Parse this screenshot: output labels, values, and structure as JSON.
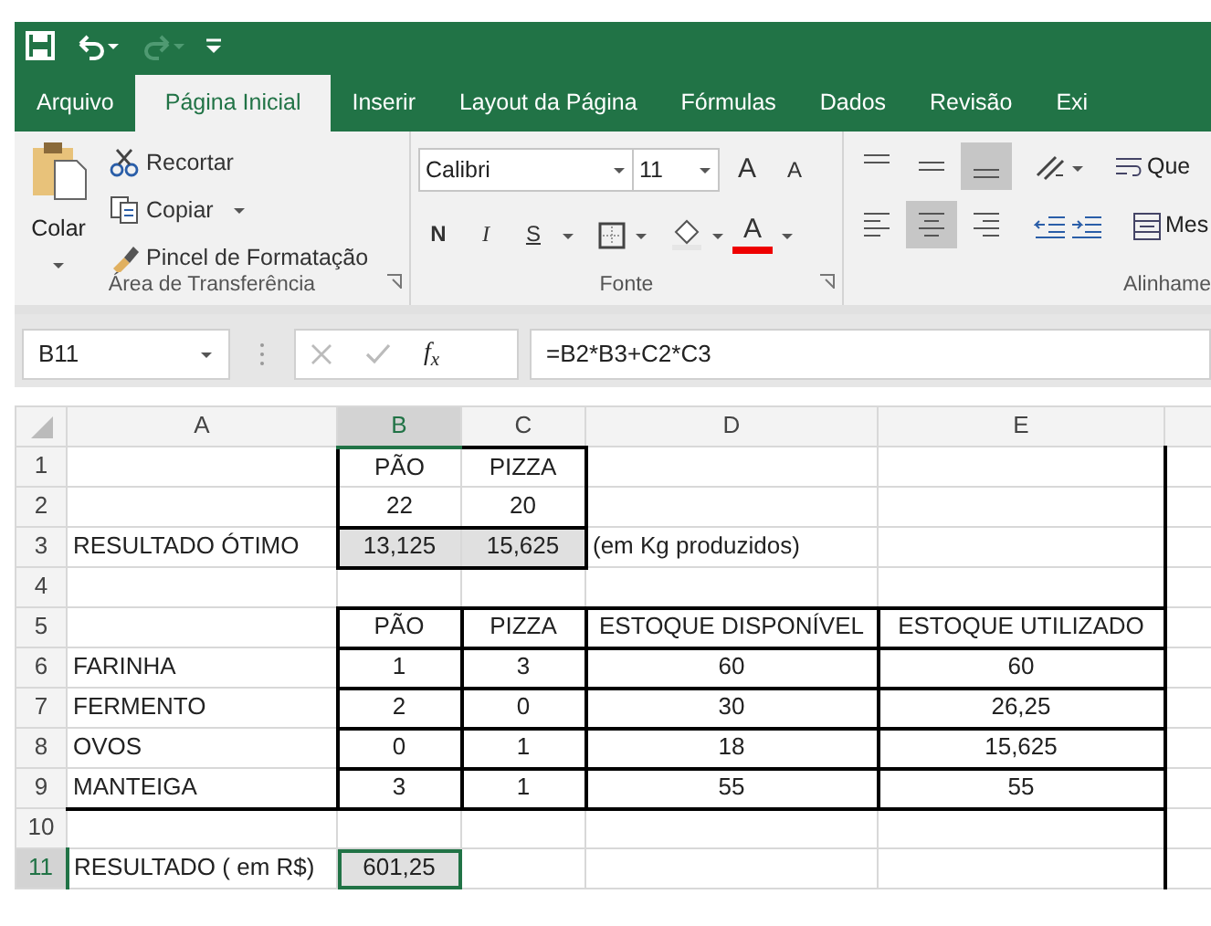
{
  "quick_access": [
    {
      "kind": "save",
      "disabled": false
    },
    {
      "kind": "undo",
      "disabled": false
    },
    {
      "kind": "redo",
      "disabled": true
    },
    {
      "kind": "customize",
      "disabled": false
    }
  ],
  "tabs": [
    {
      "label": "Arquivo",
      "selected": false
    },
    {
      "label": "Página Inicial",
      "selected": true
    },
    {
      "label": "Inserir",
      "selected": false
    },
    {
      "label": "Layout da Página",
      "selected": false
    },
    {
      "label": "Fórmulas",
      "selected": false
    },
    {
      "label": "Dados",
      "selected": false
    },
    {
      "label": "Revisão",
      "selected": false
    },
    {
      "label": "Exi",
      "selected": false
    }
  ],
  "clipboard": {
    "paste": "Colar",
    "actions": [
      {
        "kind": "cut",
        "label": "Recortar",
        "dropdown": false
      },
      {
        "kind": "copy",
        "label": "Copiar",
        "dropdown": true
      },
      {
        "kind": "painter",
        "label": "Pincel de Formatação",
        "dropdown": false
      }
    ],
    "label": "Área de Transferência"
  },
  "font": {
    "name": "Calibri",
    "size": "11",
    "grow": "A",
    "shrink": "A",
    "bold": "N",
    "italic": "I",
    "underline": "S",
    "color_letter": "A",
    "label": "Fonte"
  },
  "alignment": {
    "vertical": [
      {
        "kind": "top",
        "selected": false
      },
      {
        "kind": "middle",
        "selected": false
      },
      {
        "kind": "bottom",
        "selected": true
      }
    ],
    "horizontal": [
      {
        "kind": "left",
        "selected": false
      },
      {
        "kind": "center",
        "selected": true
      },
      {
        "kind": "right",
        "selected": false
      }
    ],
    "wrap": "Que",
    "merge": "Mes",
    "label": "Alinhame"
  },
  "formula_bar": {
    "name_box": "B11",
    "fx": "f$_{x}$",
    "formula": "=B2*B3+C2*C3"
  },
  "sheet": {
    "columns": [
      {
        "label": "A",
        "selected": false
      },
      {
        "label": "B",
        "selected": true
      },
      {
        "label": "C",
        "selected": false
      },
      {
        "label": "D",
        "selected": false
      },
      {
        "label": "E",
        "selected": false
      }
    ],
    "rows": [
      {
        "number": "1",
        "selected": false,
        "cells": [
          null,
          {
            "text": "PÃO"
          },
          {
            "text": "PIZZA"
          },
          null,
          null
        ]
      },
      {
        "number": "2",
        "selected": false,
        "cells": [
          null,
          {
            "text": "22"
          },
          {
            "text": "20"
          },
          null,
          null
        ]
      },
      {
        "number": "3",
        "selected": false,
        "cells": [
          {
            "text": "RESULTADO ÓTIMO"
          },
          {
            "text": "13,125",
            "shaded": true
          },
          {
            "text": "15,625",
            "shaded": true
          },
          {
            "text": "(em Kg produzidos)"
          },
          null
        ]
      },
      {
        "number": "4",
        "selected": false,
        "cells": [
          null,
          null,
          null,
          null,
          null
        ]
      },
      {
        "number": "5",
        "selected": false,
        "cells": [
          null,
          {
            "text": "PÃO"
          },
          {
            "text": "PIZZA"
          },
          {
            "text": "ESTOQUE DISPONÍVEL"
          },
          {
            "text": "ESTOQUE UTILIZADO"
          }
        ]
      },
      {
        "number": "6",
        "selected": false,
        "cells": [
          {
            "text": "FARINHA"
          },
          {
            "text": "1"
          },
          {
            "text": "3"
          },
          {
            "text": "60"
          },
          {
            "text": "60"
          }
        ]
      },
      {
        "number": "7",
        "selected": false,
        "cells": [
          {
            "text": "FERMENTO"
          },
          {
            "text": "2"
          },
          {
            "text": "0"
          },
          {
            "text": "30"
          },
          {
            "text": "26,25"
          }
        ]
      },
      {
        "number": "8",
        "selected": false,
        "cells": [
          {
            "text": "OVOS"
          },
          {
            "text": "0"
          },
          {
            "text": "1"
          },
          {
            "text": "18"
          },
          {
            "text": "15,625"
          }
        ]
      },
      {
        "number": "9",
        "selected": false,
        "cells": [
          {
            "text": "MANTEIGA"
          },
          {
            "text": "3"
          },
          {
            "text": "1"
          },
          {
            "text": "55"
          },
          {
            "text": "55"
          }
        ]
      },
      {
        "number": "10",
        "selected": false,
        "cells": [
          null,
          null,
          null,
          null,
          null
        ]
      },
      {
        "number": "11",
        "selected": true,
        "cells": [
          {
            "text": "RESULTADO ( em R$)"
          },
          {
            "text": "601,25",
            "shaded": true
          },
          null,
          null,
          null
        ]
      }
    ]
  }
}
